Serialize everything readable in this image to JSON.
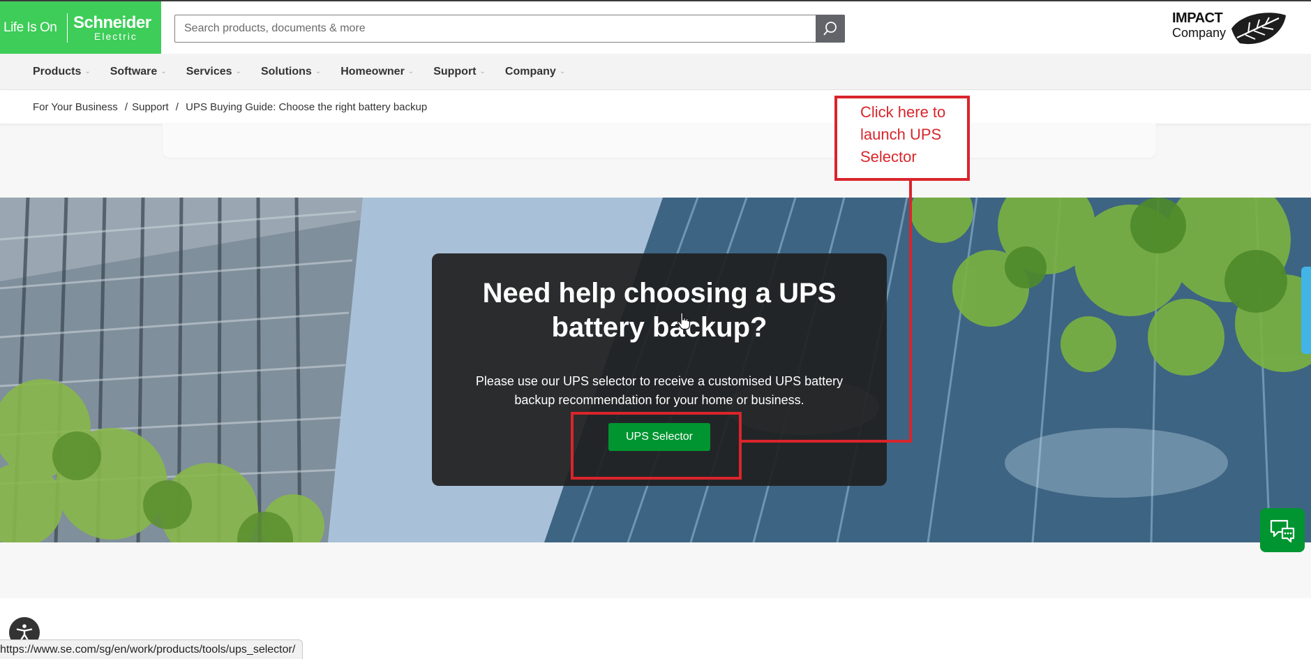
{
  "header": {
    "logo_tagline": "Life Is On",
    "logo_brand": "Schneider",
    "logo_brand_sub": "Electric",
    "search_placeholder": "Search products, documents & more",
    "impact_line1": "IMPACT",
    "impact_line2": "Company"
  },
  "nav": {
    "items": [
      "Products",
      "Software",
      "Services",
      "Solutions",
      "Homeowner",
      "Support",
      "Company"
    ]
  },
  "breadcrumb": {
    "items": [
      "For Your Business",
      "Support",
      "UPS Buying Guide: Choose the right battery backup"
    ]
  },
  "hero": {
    "title": "Need help choosing a UPS battery backup?",
    "description": "Please use our UPS selector to receive a customised UPS battery backup recommendation for your home or business.",
    "cta_label": "UPS Selector"
  },
  "annotation": {
    "text": "Click here to launch UPS Selector"
  },
  "status_bar": {
    "url": "https://www.se.com/sg/en/work/products/tools/ups_selector/"
  },
  "colors": {
    "brand_green": "#3dcd58",
    "cta_green": "#009530",
    "annotation_red": "#d9252b",
    "feedback_blue": "#42b4e6"
  }
}
